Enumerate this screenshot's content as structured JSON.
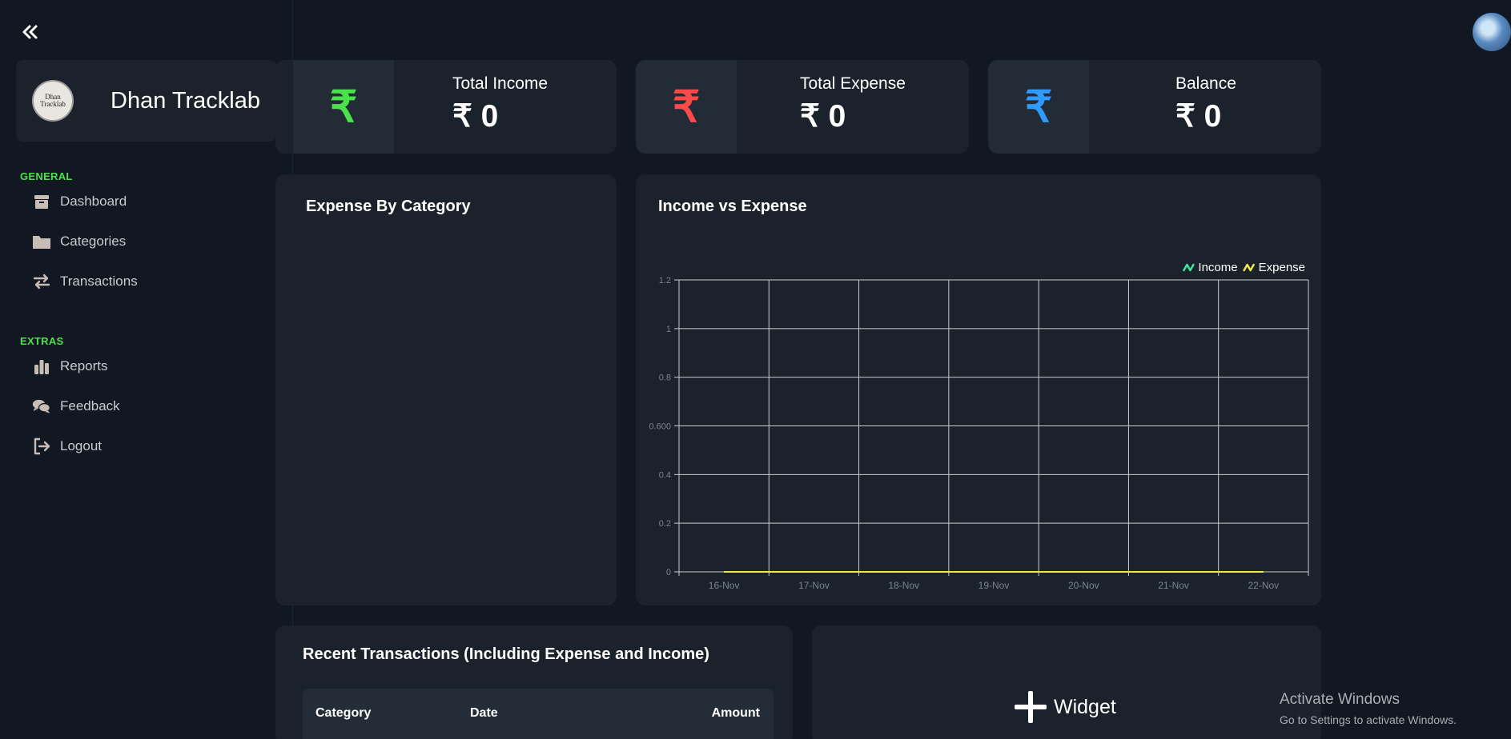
{
  "sidebar": {
    "brand": {
      "name": "Dhan Tracklab",
      "logo_text": "Dhan Tracklab"
    },
    "sections": [
      {
        "label": "GENERAL",
        "items": [
          {
            "label": "Dashboard",
            "icon": "box-icon"
          },
          {
            "label": "Categories",
            "icon": "folder-icon"
          },
          {
            "label": "Transactions",
            "icon": "arrows-exchange-icon"
          }
        ]
      },
      {
        "label": "EXTRAS",
        "items": [
          {
            "label": "Reports",
            "icon": "bar-chart-icon"
          },
          {
            "label": "Feedback",
            "icon": "chat-bubbles-icon"
          },
          {
            "label": "Logout",
            "icon": "logout-icon"
          }
        ]
      }
    ]
  },
  "stats": [
    {
      "title": "Total Income",
      "value": "₹ 0",
      "icon": "₹",
      "color": "#4ae14a"
    },
    {
      "title": "Total Expense",
      "value": "₹ 0",
      "icon": "₹",
      "color": "#ff4a4a"
    },
    {
      "title": "Balance",
      "value": "₹ 0",
      "icon": "₹",
      "color": "#2f9bff"
    }
  ],
  "panels": {
    "expense_by_category": {
      "title": "Expense By Category"
    },
    "income_vs_expense": {
      "title": "Income vs Expense"
    },
    "recent_transactions": {
      "title": "Recent Transactions (Including Expense and Income)",
      "columns": [
        "Category",
        "Date",
        "Amount"
      ]
    },
    "widget": {
      "label": "Widget"
    }
  },
  "chart_data": {
    "type": "line",
    "title": "Income vs Expense",
    "categories": [
      "16-Nov",
      "17-Nov",
      "18-Nov",
      "19-Nov",
      "20-Nov",
      "21-Nov",
      "22-Nov"
    ],
    "y_ticks": [
      "0",
      "0.2",
      "0.4",
      "0.600",
      "0.8",
      "1",
      "1.2"
    ],
    "ylim": [
      0,
      1.2
    ],
    "series": [
      {
        "name": "Income",
        "values": [
          0,
          0,
          0,
          0,
          0,
          0,
          0
        ],
        "color": "#3ee6a3"
      },
      {
        "name": "Expense",
        "values": [
          0,
          0,
          0,
          0,
          0,
          0,
          0
        ],
        "color": "#f2e94a"
      }
    ],
    "grid": true,
    "legend": "top-right"
  },
  "os_overlay": {
    "line1": "Activate Windows",
    "line2": "Go to Settings to activate Windows."
  },
  "colors": {
    "background": "#121821",
    "card": "#1b222c",
    "section_label": "#4ae14a"
  }
}
